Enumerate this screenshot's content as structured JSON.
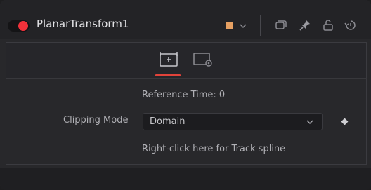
{
  "node": {
    "title": "PlanarTransform1",
    "enabled": true,
    "color_swatch": "#e6a062",
    "header_icons": [
      "versions-icon",
      "pin-icon",
      "lock-icon",
      "reset-icon"
    ]
  },
  "tabs": [
    {
      "icon": "transform-controls-icon",
      "active": true
    },
    {
      "icon": "settings-icon",
      "active": false
    }
  ],
  "controls": {
    "reference_time": "Reference Time: 0",
    "clipping_mode_label": "Clipping Mode",
    "clipping_mode_value": "Domain",
    "track_spline_hint": "Right-click here for Track spline"
  },
  "colors": {
    "accent_red": "#f0313a",
    "tab_underline": "#e2433a"
  }
}
